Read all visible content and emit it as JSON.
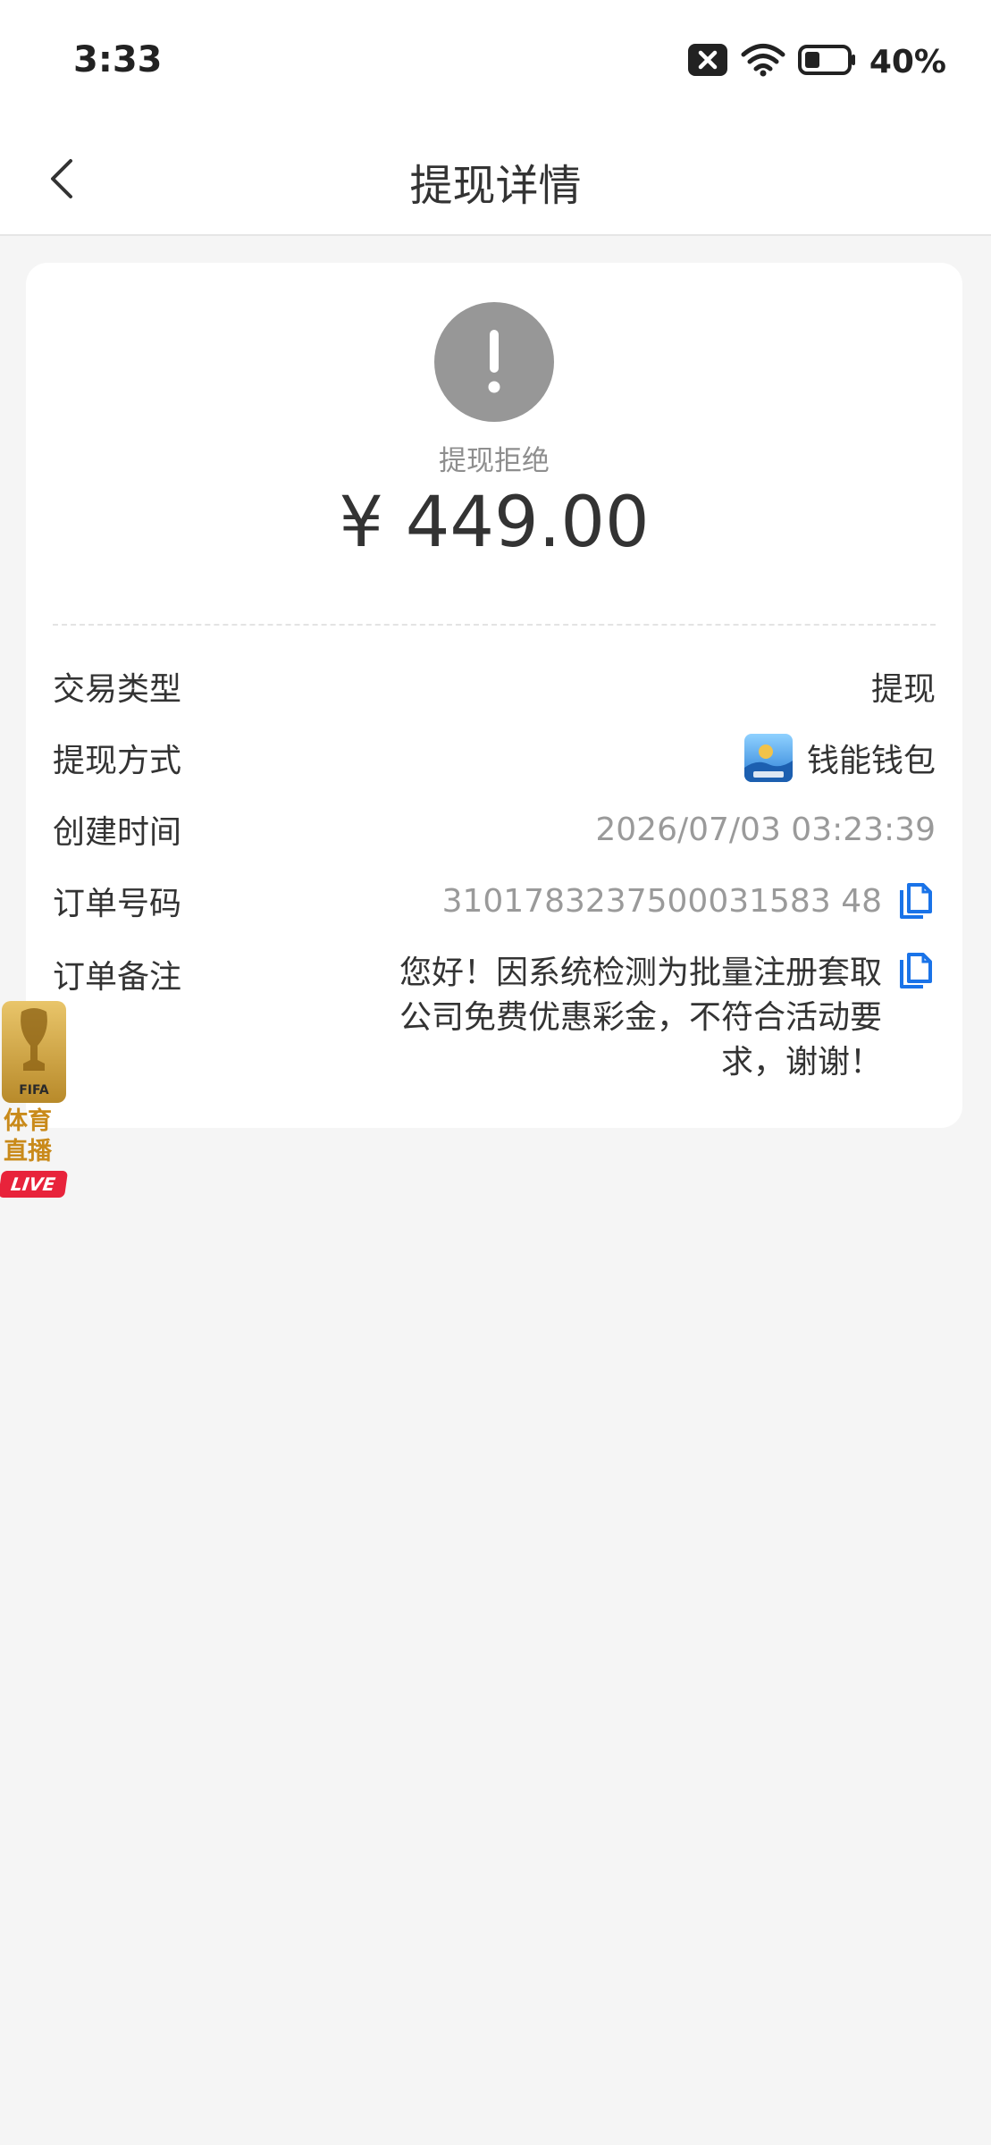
{
  "status_bar": {
    "time": "3:33",
    "battery": "40%"
  },
  "nav": {
    "title": "提现详情"
  },
  "summary": {
    "status": "提现拒绝",
    "amount": "¥ 449.00"
  },
  "details": {
    "type_label": "交易类型",
    "type_value": "提现",
    "method_label": "提现方式",
    "method_value": "钱能钱包",
    "created_label": "创建时间",
    "created_value": "2026/07/03 03:23:39",
    "order_label": "订单号码",
    "order_value": "3101783237500031583 48",
    "remark_label": "订单备注",
    "remark_value": "您好！因系统检测为批量注册套取公司免费优惠彩金，不符合活动要求，谢谢！"
  },
  "promo": {
    "badge_text": "FIFA",
    "line1": "体育",
    "line2": "直播",
    "live": "LIVE"
  },
  "colors": {
    "accent": "#1a73e8",
    "status_grey": "#979797",
    "promo_gold": "#c98a1a",
    "live_red": "#e8233b"
  },
  "icons": [
    "back-chevron-icon",
    "signal-x-icon",
    "wifi-icon",
    "battery-icon",
    "exclamation-icon",
    "wallet-app-icon",
    "copy-icon"
  ]
}
